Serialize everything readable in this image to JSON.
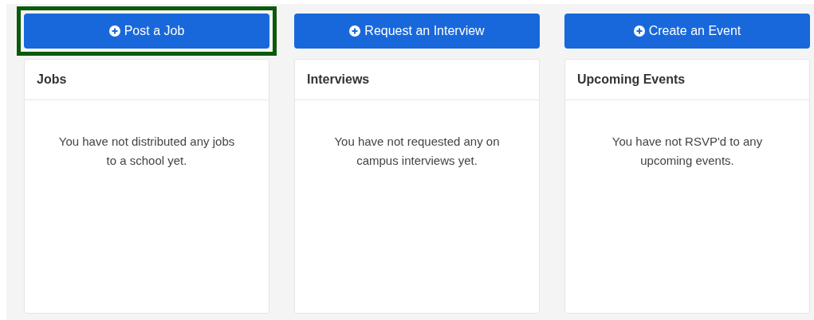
{
  "columns": [
    {
      "button": "Post a Job",
      "highlighted": true,
      "title": "Jobs",
      "message": "You have not distributed any jobs to a school yet."
    },
    {
      "button": "Request an Interview",
      "highlighted": false,
      "title": "Interviews",
      "message": "You have not requested any on campus interviews yet."
    },
    {
      "button": "Create an Event",
      "highlighted": false,
      "title": "Upcoming Events",
      "message": "You have not RSVP'd to any upcoming events."
    }
  ]
}
